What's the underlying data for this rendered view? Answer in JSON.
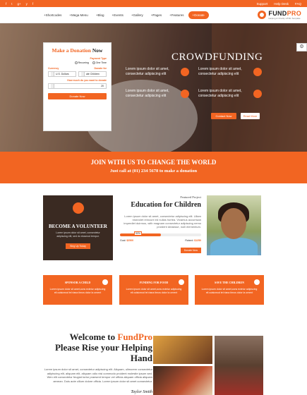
{
  "topbar": {
    "social": [
      "f",
      "t",
      "g+",
      "y",
      "f"
    ],
    "links": [
      "Support",
      "Help Desk",
      "FAQ"
    ]
  },
  "nav": {
    "items": [
      "+Shortcodes",
      "+Mega Menu",
      "+Blog",
      "+Events",
      "+Gallery",
      "+Pages",
      "+Features"
    ],
    "donate": "+Donate"
  },
  "logo": {
    "name_a": "FUND",
    "name_b": "PRO",
    "tagline": "Helping & Charity HTML Template"
  },
  "form": {
    "title_a": "Make a ",
    "title_b": "Donation",
    "title_c": " Now",
    "payment_label": "Payment Type",
    "opt1": "Recurring",
    "opt2": "One Time",
    "currency_label": "Currency",
    "currency": "U.S. Dollars",
    "donate_for_label": "Donate for",
    "donate_for": "ate Children",
    "amount_label": "How much do you want to donate",
    "amount": "20",
    "button": "Donate Now"
  },
  "hero": {
    "title": "CROWDFUNDING",
    "features": [
      "Lorem ipsum dolor sit amet, consectetur adipiscing elit",
      "Lorem ipsum dolor sit amet, consectetur adipiscing elit",
      "Lorem ipsum dolor sit amet, consectetur adipiscing elit",
      "Lorem ipsum dolor sit amet, consectetur adipiscing elit"
    ],
    "btn_primary": "Contact Now",
    "btn_secondary": "Read More"
  },
  "join": {
    "heading": "JOIN WITH US TO CHANGE THE WORLD",
    "subheading": "Just call at (01) 234 5678 to make a donation"
  },
  "volunteer": {
    "title": "BECOME A VOLUNTEER",
    "desc": "Lorem ipsum dolor sit amet, consectetur adipiscing elit, sed do eiusmod tempor.",
    "button": "Sing Up Today"
  },
  "project": {
    "kicker": "Featured Project",
    "title": "Education for Children",
    "desc": "Lorem ipsum dolor sit amet, consectetur adipiscing elit. Ullam nisevolet reincunt ed nullas hortea. Vivamus accumsan imperdiet duirmus, with magnam consectetur adipiscing nemo proident deasisse, nulli elementum.",
    "progress_label": "50%",
    "progress": 0.5,
    "goal_label": "Goal:",
    "goal": "$2500",
    "raised_label": "Raised:",
    "raised": "$1250",
    "button": "Donate Now"
  },
  "cards": [
    {
      "title": "SPONSOR A CHILD",
      "desc": "Lorem ipsum dolor sit amet,cons ectetur adipiscing eli cuisicmod tel riana tirnos dolor la ornent"
    },
    {
      "title": "FUNDING FOR FOOD",
      "desc": "Lorem ipsum dolor sit amet,cons ectetur adipiscing eli cuisicmod tel riana tirnos dolor la ornent"
    },
    {
      "title": "SAVE THE CHILDREN",
      "desc": "Lorem ipsum dolor sit amet,cons ectetur adipiscing eli cuisicmod tel riana tirnos dolor la ornent"
    }
  ],
  "welcome": {
    "title_a": "Welcome to ",
    "title_b": "FundPro",
    "title_c": " Please Rise your Helping Hand",
    "desc": "Lorem ipsum dolor sit amet, consectetur adipiscing elit. Aliquam, ullmorem consectetur adipiscing elit, aliquam elit, aliquam odio nisi commodo proident molestie ipsum sed. Wen elit consectetur feugiat tortor praesent tempor vel officia aliquam officia aliquam aenean. Duis aute cillum dolore officia. Lorem ipsum dolor sit amet consectetur.",
    "signature": "Taylor Smith"
  },
  "colors": {
    "accent": "#f26522",
    "dark": "#222222"
  }
}
